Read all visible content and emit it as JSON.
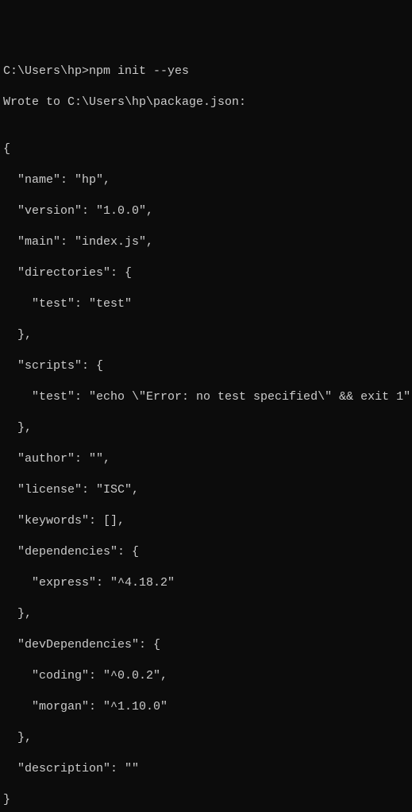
{
  "terminal": {
    "prompt_line": "C:\\Users\\hp>npm init --yes",
    "wrote_line": "Wrote to C:\\Users\\hp\\package.json:",
    "blank": "",
    "json_lines": {
      "open": "{",
      "name": "  \"name\": \"hp\",",
      "version": "  \"version\": \"1.0.0\",",
      "main": "  \"main\": \"index.js\",",
      "directories_open": "  \"directories\": {",
      "directories_test": "    \"test\": \"test\"",
      "directories_close": "  },",
      "scripts_open": "  \"scripts\": {",
      "scripts_test": "    \"test\": \"echo \\\"Error: no test specified\\\" && exit 1\"",
      "scripts_close": "  },",
      "author": "  \"author\": \"\",",
      "license": "  \"license\": \"ISC\",",
      "keywords": "  \"keywords\": [],",
      "dependencies_open": "  \"dependencies\": {",
      "dependencies_express": "    \"express\": \"^4.18.2\"",
      "dependencies_close": "  },",
      "devdeps_open": "  \"devDependencies\": {",
      "devdeps_coding": "    \"coding\": \"^0.0.2\",",
      "devdeps_morgan": "    \"morgan\": \"^1.10.0\"",
      "devdeps_close": "  },",
      "description": "  \"description\": \"\"",
      "close": "}"
    }
  }
}
